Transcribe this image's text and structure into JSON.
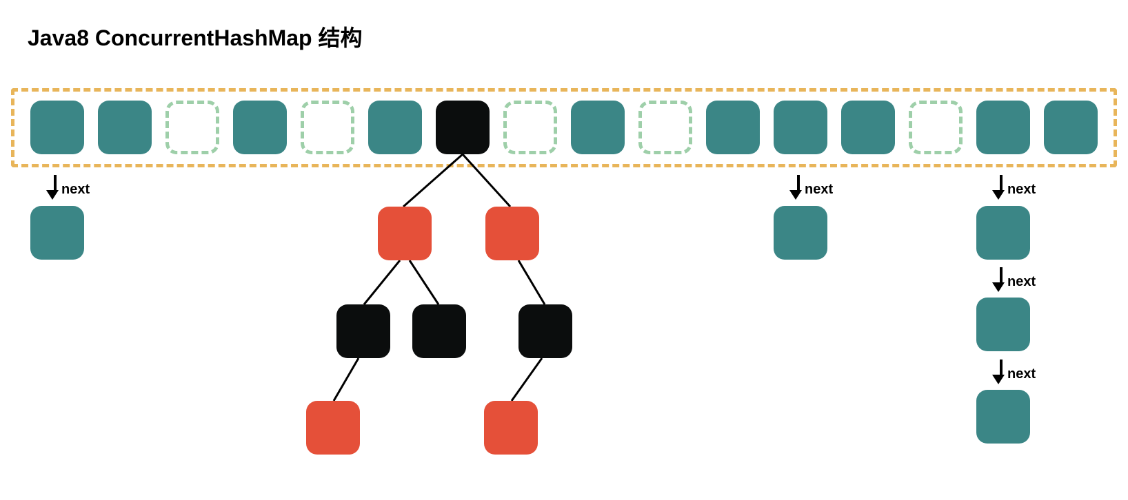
{
  "title": "Java8 ConcurrentHashMap 结构",
  "labels": {
    "next": "next"
  },
  "colors": {
    "teal": "#3b8686",
    "black": "#0b0d0d",
    "red": "#e55039",
    "outer_dash": "#e8b55a",
    "empty_dash": "#9ecfa9"
  },
  "array_slots": [
    {
      "index": 0,
      "type": "filled",
      "color": "teal",
      "chain": [
        "teal"
      ]
    },
    {
      "index": 1,
      "type": "filled",
      "color": "teal"
    },
    {
      "index": 2,
      "type": "empty"
    },
    {
      "index": 3,
      "type": "filled",
      "color": "teal"
    },
    {
      "index": 4,
      "type": "empty"
    },
    {
      "index": 5,
      "type": "filled",
      "color": "teal"
    },
    {
      "index": 6,
      "type": "filled",
      "color": "black",
      "tree_root": true
    },
    {
      "index": 7,
      "type": "empty"
    },
    {
      "index": 8,
      "type": "filled",
      "color": "teal"
    },
    {
      "index": 9,
      "type": "empty"
    },
    {
      "index": 10,
      "type": "filled",
      "color": "teal"
    },
    {
      "index": 11,
      "type": "filled",
      "color": "teal",
      "chain": [
        "teal"
      ]
    },
    {
      "index": 12,
      "type": "filled",
      "color": "teal"
    },
    {
      "index": 13,
      "type": "empty"
    },
    {
      "index": 14,
      "type": "filled",
      "color": "teal",
      "chain": [
        "teal",
        "teal",
        "teal"
      ]
    },
    {
      "index": 15,
      "type": "filled",
      "color": "teal"
    }
  ],
  "tree": {
    "root": {
      "color": "black",
      "left": {
        "color": "red",
        "left": {
          "color": "black",
          "left": {
            "color": "red"
          }
        },
        "right": {
          "color": "black"
        }
      },
      "right": {
        "color": "red",
        "right": {
          "color": "black",
          "left": {
            "color": "red"
          }
        }
      }
    }
  }
}
